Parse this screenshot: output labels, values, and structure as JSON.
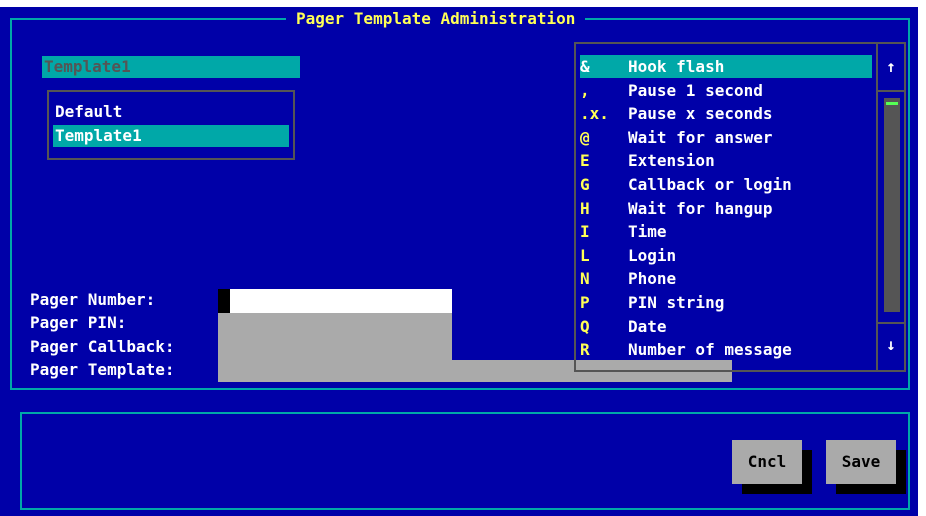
{
  "window": {
    "title": "Pager Template Administration"
  },
  "template_name": {
    "value": "Template1"
  },
  "templates": [
    {
      "label": "Default",
      "selected": false
    },
    {
      "label": "Template1",
      "selected": true
    }
  ],
  "fields": {
    "pager_number": {
      "label": "Pager Number:",
      "value": ""
    },
    "pager_pin": {
      "label": "Pager PIN:",
      "value": ""
    },
    "pager_callback": {
      "label": "Pager Callback:",
      "value": ""
    },
    "pager_template": {
      "label": "Pager Template:",
      "value": ""
    }
  },
  "codes": [
    {
      "code": "&",
      "desc": "Hook flash",
      "selected": true
    },
    {
      "code": ",",
      "desc": "Pause 1 second"
    },
    {
      "code": ".x.",
      "desc": "Pause x seconds"
    },
    {
      "code": "@",
      "desc": "Wait for answer"
    },
    {
      "code": "E",
      "desc": "Extension"
    },
    {
      "code": "G",
      "desc": "Callback or login"
    },
    {
      "code": "H",
      "desc": "Wait for hangup"
    },
    {
      "code": "I",
      "desc": "Time"
    },
    {
      "code": "L",
      "desc": "Login"
    },
    {
      "code": "N",
      "desc": "Phone"
    },
    {
      "code": "P",
      "desc": "PIN string"
    },
    {
      "code": "Q",
      "desc": "Date"
    },
    {
      "code": "R",
      "desc": "Number of message"
    }
  ],
  "scrollbar": {
    "up_icon": "↑",
    "down_icon": "↓"
  },
  "buttons": {
    "cancel": "Cncl",
    "save": "Save"
  },
  "colors": {
    "background": "#0000a8",
    "frame": "#00a8a8",
    "title": "#ffff55",
    "field": "#aaaaaa"
  }
}
